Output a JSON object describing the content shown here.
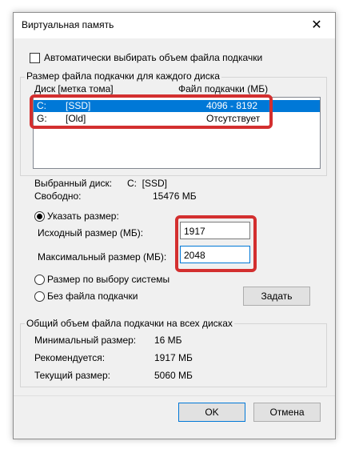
{
  "window": {
    "title": "Виртуальная память",
    "close_glyph": "✕"
  },
  "auto": {
    "label": "Автоматически выбирать объем файла подкачки",
    "checked": false
  },
  "drives_group": {
    "label": "Размер файла подкачки для каждого диска",
    "col_disk": "Диск [метка тома]",
    "col_file": "Файл подкачки (МБ)",
    "rows": [
      {
        "letter": "C:",
        "label": "[SSD]",
        "size": "4096 - 8192"
      },
      {
        "letter": "G:",
        "label": "[Old]",
        "size": "Отсутствует"
      }
    ]
  },
  "selected": {
    "drive_label": "Выбранный диск:",
    "drive_value": "C:  [SSD]",
    "free_label": "Свободно:",
    "free_value": "15476 МБ"
  },
  "custom": {
    "radio_label": "Указать размер:",
    "initial_label": "Исходный размер (МБ):",
    "initial_value": "1917",
    "max_label": "Максимальный размер (МБ):",
    "max_value": "2048"
  },
  "system_radio": "Размер по выбору системы",
  "none_radio": "Без файла подкачки",
  "set_button": "Задать",
  "total_group": {
    "label": "Общий объем файла подкачки на всех дисках",
    "min_label": "Минимальный размер:",
    "min_value": "16 МБ",
    "rec_label": "Рекомендуется:",
    "rec_value": "1917 МБ",
    "cur_label": "Текущий размер:",
    "cur_value": "5060 МБ"
  },
  "buttons": {
    "ok": "OK",
    "cancel": "Отмена"
  },
  "colors": {
    "selection": "#0078d7",
    "highlight": "#d32f2f"
  }
}
